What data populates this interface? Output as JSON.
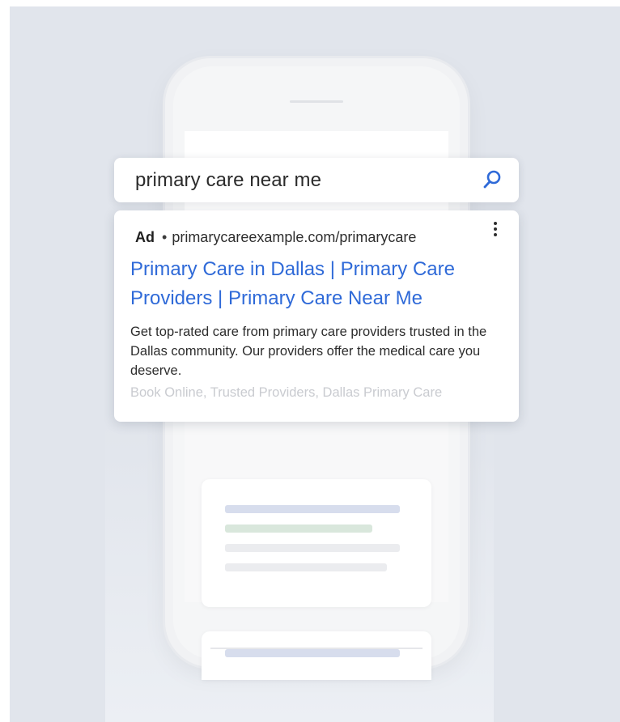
{
  "search": {
    "query": "primary care near me"
  },
  "ad": {
    "label": "Ad",
    "separator": "•",
    "url": "primarycareexample.com/primarycare",
    "title": "Primary Care in Dallas | Primary Care Providers | Primary Care Near Me",
    "description": "Get top-rated care from primary care providers trusted in the Dallas community. Our providers offer the medical care you deserve.",
    "extensions": "Book Online, Trusted Providers, Dallas Primary Care"
  },
  "icons": {
    "search": "search-icon",
    "menu": "more-vertical-icon"
  },
  "colors": {
    "link_blue": "#2f6ad8",
    "search_icon": "#2f6ad8",
    "background": "#e1e5ec"
  }
}
